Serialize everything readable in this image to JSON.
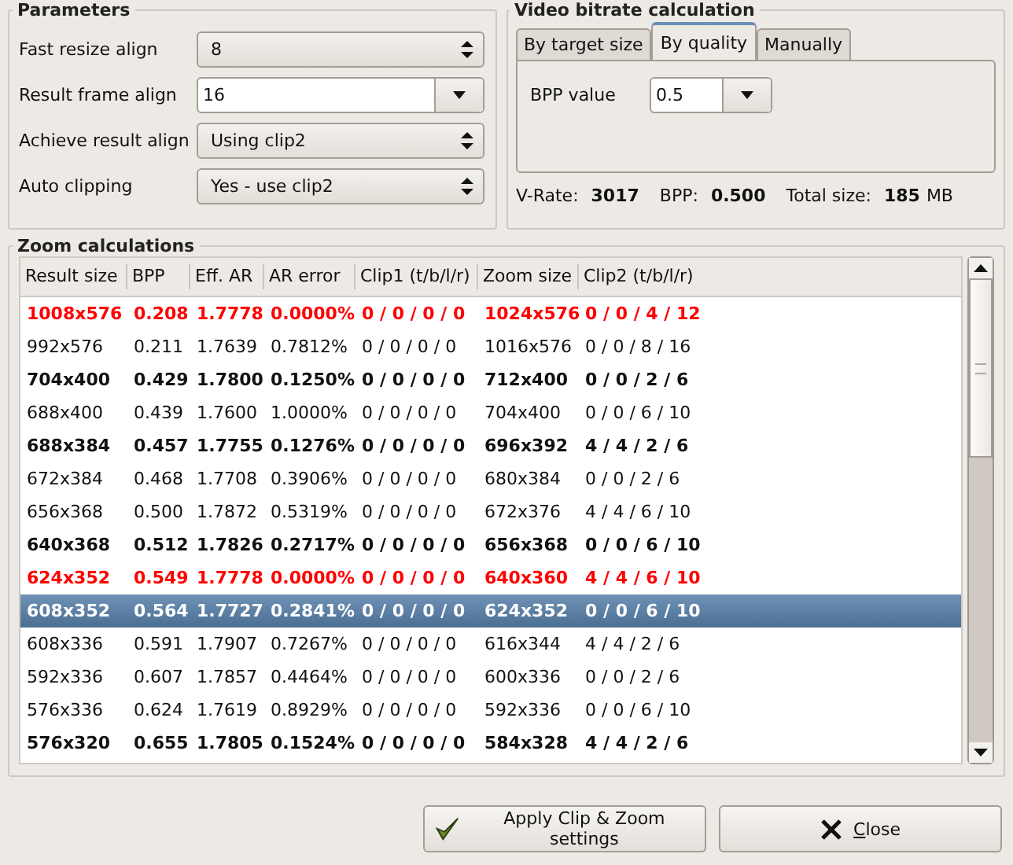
{
  "parameters": {
    "title": "Parameters",
    "fields": [
      {
        "label": "Fast resize align",
        "value": "8",
        "kind": "spin"
      },
      {
        "label": "Result frame align",
        "value": "16",
        "kind": "editable"
      },
      {
        "label": "Achieve result align",
        "value": "Using clip2",
        "kind": "spin"
      },
      {
        "label": "Auto clipping",
        "value": "Yes - use clip2",
        "kind": "spin"
      }
    ]
  },
  "bitrate": {
    "title": "Video bitrate calculation",
    "tabs": [
      {
        "label": "By target size",
        "selected": false
      },
      {
        "label": "By quality",
        "selected": true
      },
      {
        "label": "Manually",
        "selected": false
      }
    ],
    "bpp_label": "BPP value",
    "bpp_value": "0.5",
    "stats": [
      {
        "label": "V-Rate:",
        "value": "3017"
      },
      {
        "label": "BPP:",
        "value": "0.500"
      },
      {
        "label": "Total size:",
        "value": "185",
        "unit": "MB"
      }
    ]
  },
  "zoom": {
    "title": "Zoom calculations",
    "columns": [
      "Result size",
      "BPP",
      "Eff. AR",
      "AR error",
      "Clip1 (t/b/l/r)",
      "Zoom size",
      "Clip2 (t/b/l/r)"
    ],
    "rows": [
      {
        "cells": [
          "1008x576",
          "0.208",
          "1.7778",
          "0.0000%",
          "0 / 0 / 0 / 0",
          "1024x576",
          "0 / 0 / 4 / 12"
        ],
        "kind": "red",
        "selected": false
      },
      {
        "cells": [
          "992x576",
          "0.211",
          "1.7639",
          "0.7812%",
          "0 / 0 / 0 / 0",
          "1016x576",
          "0 / 0 / 8 / 16"
        ],
        "kind": "plain",
        "selected": false
      },
      {
        "cells": [
          "704x400",
          "0.429",
          "1.7800",
          "0.1250%",
          "0 / 0 / 0 / 0",
          "712x400",
          "0 / 0 / 2 / 6"
        ],
        "kind": "bold",
        "selected": false
      },
      {
        "cells": [
          "688x400",
          "0.439",
          "1.7600",
          "1.0000%",
          "0 / 0 / 0 / 0",
          "704x400",
          "0 / 0 / 6 / 10"
        ],
        "kind": "plain",
        "selected": false
      },
      {
        "cells": [
          "688x384",
          "0.457",
          "1.7755",
          "0.1276%",
          "0 / 0 / 0 / 0",
          "696x392",
          "4 / 4 / 2 / 6"
        ],
        "kind": "bold",
        "selected": false
      },
      {
        "cells": [
          "672x384",
          "0.468",
          "1.7708",
          "0.3906%",
          "0 / 0 / 0 / 0",
          "680x384",
          "0 / 0 / 2 / 6"
        ],
        "kind": "plain",
        "selected": false
      },
      {
        "cells": [
          "656x368",
          "0.500",
          "1.7872",
          "0.5319%",
          "0 / 0 / 0 / 0",
          "672x376",
          "4 / 4 / 6 / 10"
        ],
        "kind": "plain",
        "selected": false
      },
      {
        "cells": [
          "640x368",
          "0.512",
          "1.7826",
          "0.2717%",
          "0 / 0 / 0 / 0",
          "656x368",
          "0 / 0 / 6 / 10"
        ],
        "kind": "bold",
        "selected": false
      },
      {
        "cells": [
          "624x352",
          "0.549",
          "1.7778",
          "0.0000%",
          "0 / 0 / 0 / 0",
          "640x360",
          "4 / 4 / 6 / 10"
        ],
        "kind": "red",
        "selected": false
      },
      {
        "cells": [
          "608x352",
          "0.564",
          "1.7727",
          "0.2841%",
          "0 / 0 / 0 / 0",
          "624x352",
          "0 / 0 / 6 / 10"
        ],
        "kind": "bold",
        "selected": true
      },
      {
        "cells": [
          "608x336",
          "0.591",
          "1.7907",
          "0.7267%",
          "0 / 0 / 0 / 0",
          "616x344",
          "4 / 4 / 2 / 6"
        ],
        "kind": "plain",
        "selected": false
      },
      {
        "cells": [
          "592x336",
          "0.607",
          "1.7857",
          "0.4464%",
          "0 / 0 / 0 / 0",
          "600x336",
          "0 / 0 / 2 / 6"
        ],
        "kind": "plain",
        "selected": false
      },
      {
        "cells": [
          "576x336",
          "0.624",
          "1.7619",
          "0.8929%",
          "0 / 0 / 0 / 0",
          "592x336",
          "0 / 0 / 6 / 10"
        ],
        "kind": "plain",
        "selected": false
      },
      {
        "cells": [
          "576x320",
          "0.655",
          "1.7805",
          "0.1524%",
          "0 / 0 / 0 / 0",
          "584x328",
          "4 / 4 / 2 / 6"
        ],
        "kind": "bold",
        "selected": false
      }
    ]
  },
  "buttons": [
    {
      "label": "Apply Clip & Zoom settings",
      "kind": "apply"
    },
    {
      "label": "Close",
      "kind": "close"
    }
  ]
}
